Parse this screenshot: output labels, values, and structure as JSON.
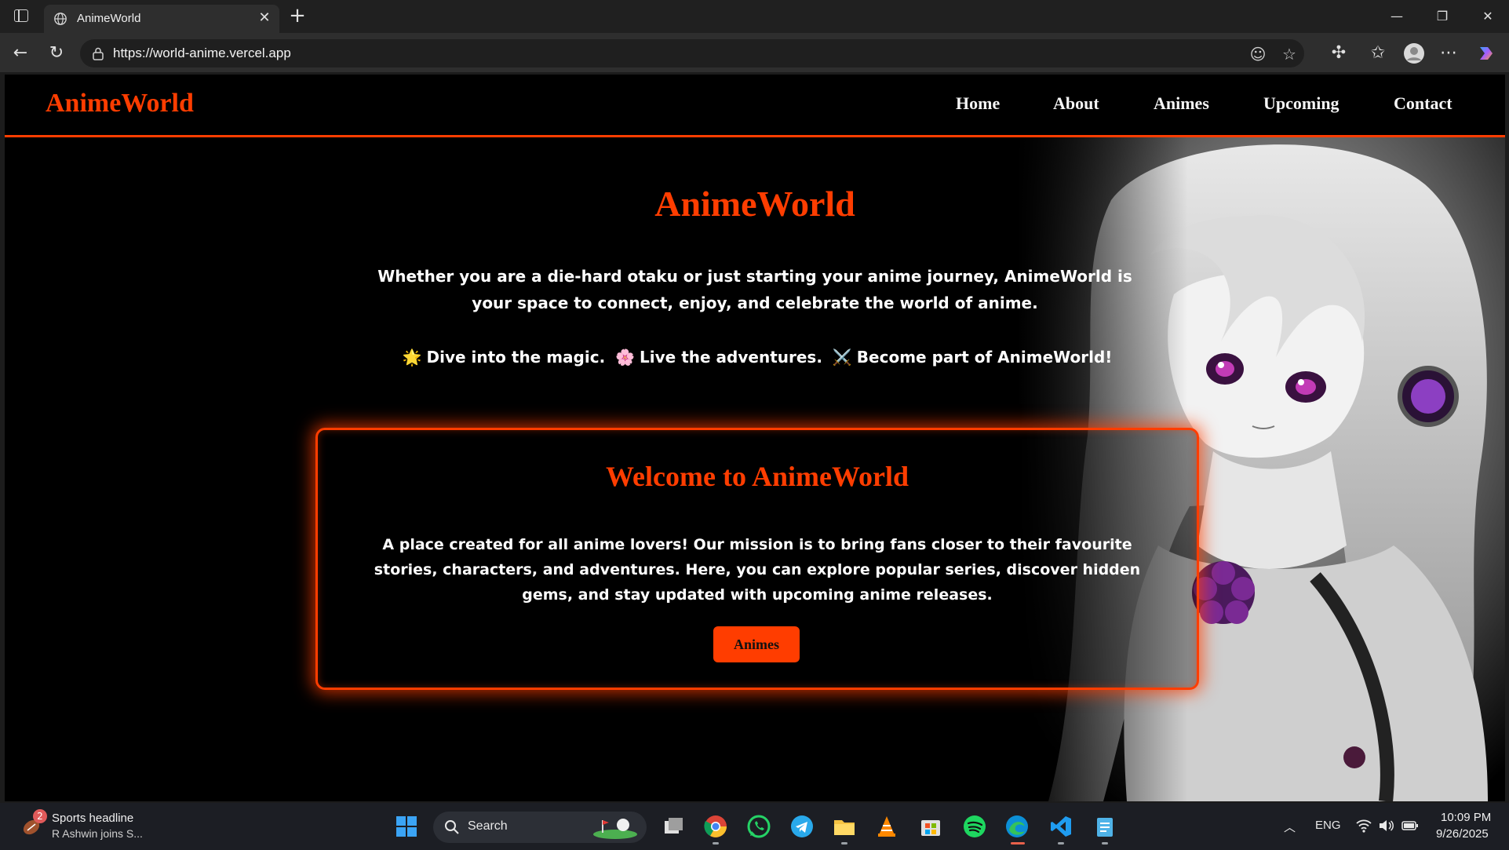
{
  "browser": {
    "tab_title": "AnimeWorld",
    "url": "https://world-anime.vercel.app"
  },
  "site": {
    "logo": "AnimeWorld",
    "nav": [
      "Home",
      "About",
      "Animes",
      "Upcoming",
      "Contact"
    ],
    "hero_title": "AnimeWorld",
    "hero_text": "Whether you are a die-hard otaku or just starting your anime journey, AnimeWorld is your space to connect, enjoy, and celebrate the world of anime.",
    "tagline": {
      "emoji1": "🌟",
      "part1": "Dive into the magic.",
      "emoji2": "🌸",
      "part2": "Live the adventures.",
      "emoji3": "⚔️",
      "part3": "Become part of AnimeWorld!"
    },
    "card": {
      "title": "Welcome to AnimeWorld",
      "text": "A place created for all anime lovers! Our mission is to bring fans closer to their favourite stories, characters, and adventures. Here, you can explore popular series, discover hidden gems, and stay updated with upcoming anime releases.",
      "button": "Animes"
    },
    "colors": {
      "accent": "#ff3d00",
      "background": "#000000"
    }
  },
  "taskbar": {
    "news_badge": "2",
    "news_title": "Sports headline",
    "news_sub": "R Ashwin joins S...",
    "search_label": "Search",
    "lang": "ENG",
    "time": "10:09 PM",
    "date": "9/26/2025"
  }
}
